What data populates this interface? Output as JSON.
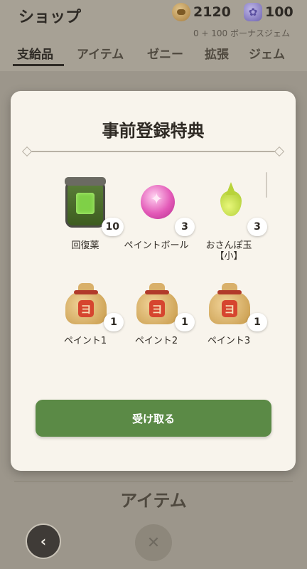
{
  "header": {
    "title": "ショップ",
    "coins": "2120",
    "gems": "100",
    "bonus_gems": "0 + 100 ボーナスジェム"
  },
  "tabs": [
    {
      "label": "支給品",
      "active": true
    },
    {
      "label": "アイテム"
    },
    {
      "label": "ゼニー"
    },
    {
      "label": "拡張"
    },
    {
      "label": "ジェム"
    }
  ],
  "background": {
    "section_title": "アイテム",
    "back_icon": "chevron-left-icon",
    "close_icon": "close-icon"
  },
  "modal": {
    "title": "事前登録特典",
    "items": [
      {
        "label": "回復薬",
        "quantity": "10",
        "icon": "potion-jar-icon"
      },
      {
        "label": "ペイントボール",
        "quantity": "3",
        "icon": "paint-ball-icon"
      },
      {
        "label": "おさんぽ玉【小】",
        "quantity": "3",
        "icon": "seed-drop-icon"
      },
      {
        "label": "ペイント1",
        "quantity": "1",
        "icon": "paint-bag-icon"
      },
      {
        "label": "ペイント2",
        "quantity": "1",
        "icon": "paint-bag-icon"
      },
      {
        "label": "ペイント3",
        "quantity": "1",
        "icon": "paint-bag-icon"
      }
    ],
    "receive_button": "受け取る"
  },
  "colors": {
    "accent_green": "#5b8a46",
    "modal_bg": "#f8f4ec",
    "overlay": "#9c968b"
  }
}
